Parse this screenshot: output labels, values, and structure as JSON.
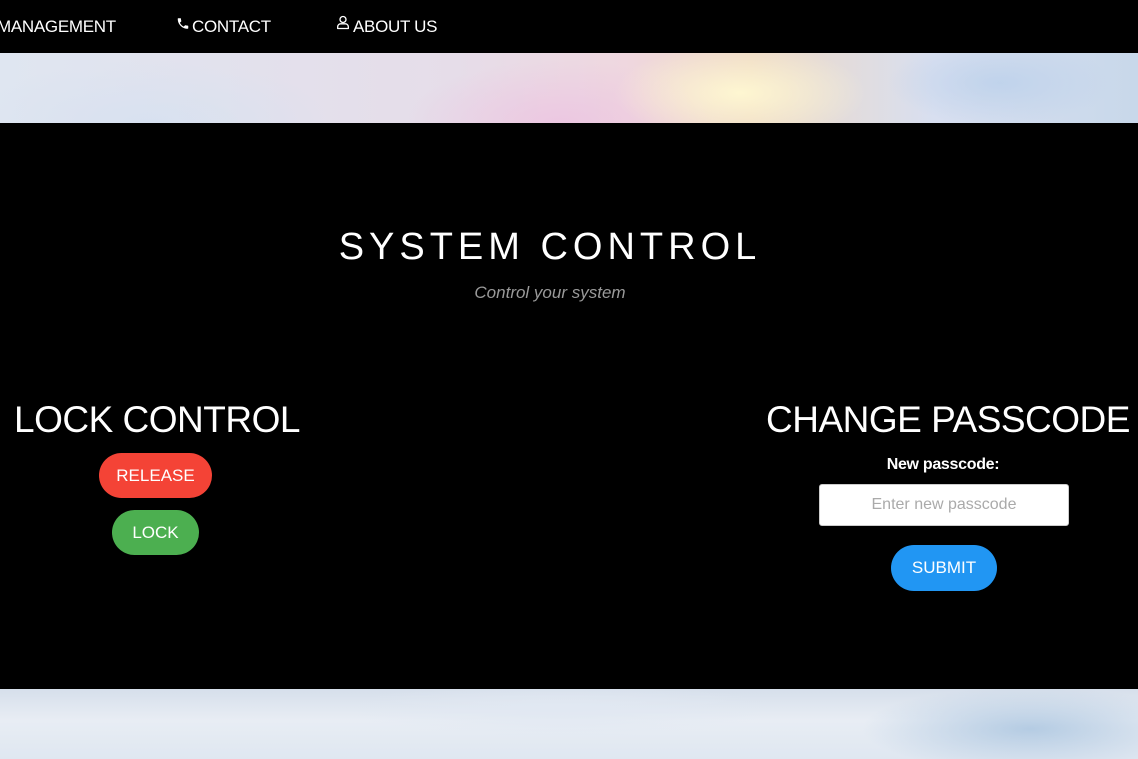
{
  "nav": {
    "items": [
      {
        "label": "MANAGEMENT",
        "icon": ""
      },
      {
        "label": "CONTACT",
        "icon": "phone-icon"
      },
      {
        "label": "ABOUT US",
        "icon": "user-icon"
      }
    ]
  },
  "system": {
    "title": "SYSTEM CONTROL",
    "subtitle": "Control your system"
  },
  "lock_control": {
    "title": "LOCK CONTROL",
    "release_label": "RELEASE",
    "lock_label": "LOCK",
    "release_color": "#f44336",
    "lock_color": "#4caf50"
  },
  "change_passcode": {
    "title": "CHANGE PASSCODE",
    "field_label": "New passcode:",
    "placeholder": "Enter new passcode",
    "value": "",
    "submit_label": "SUBMIT",
    "submit_color": "#2196f3"
  }
}
